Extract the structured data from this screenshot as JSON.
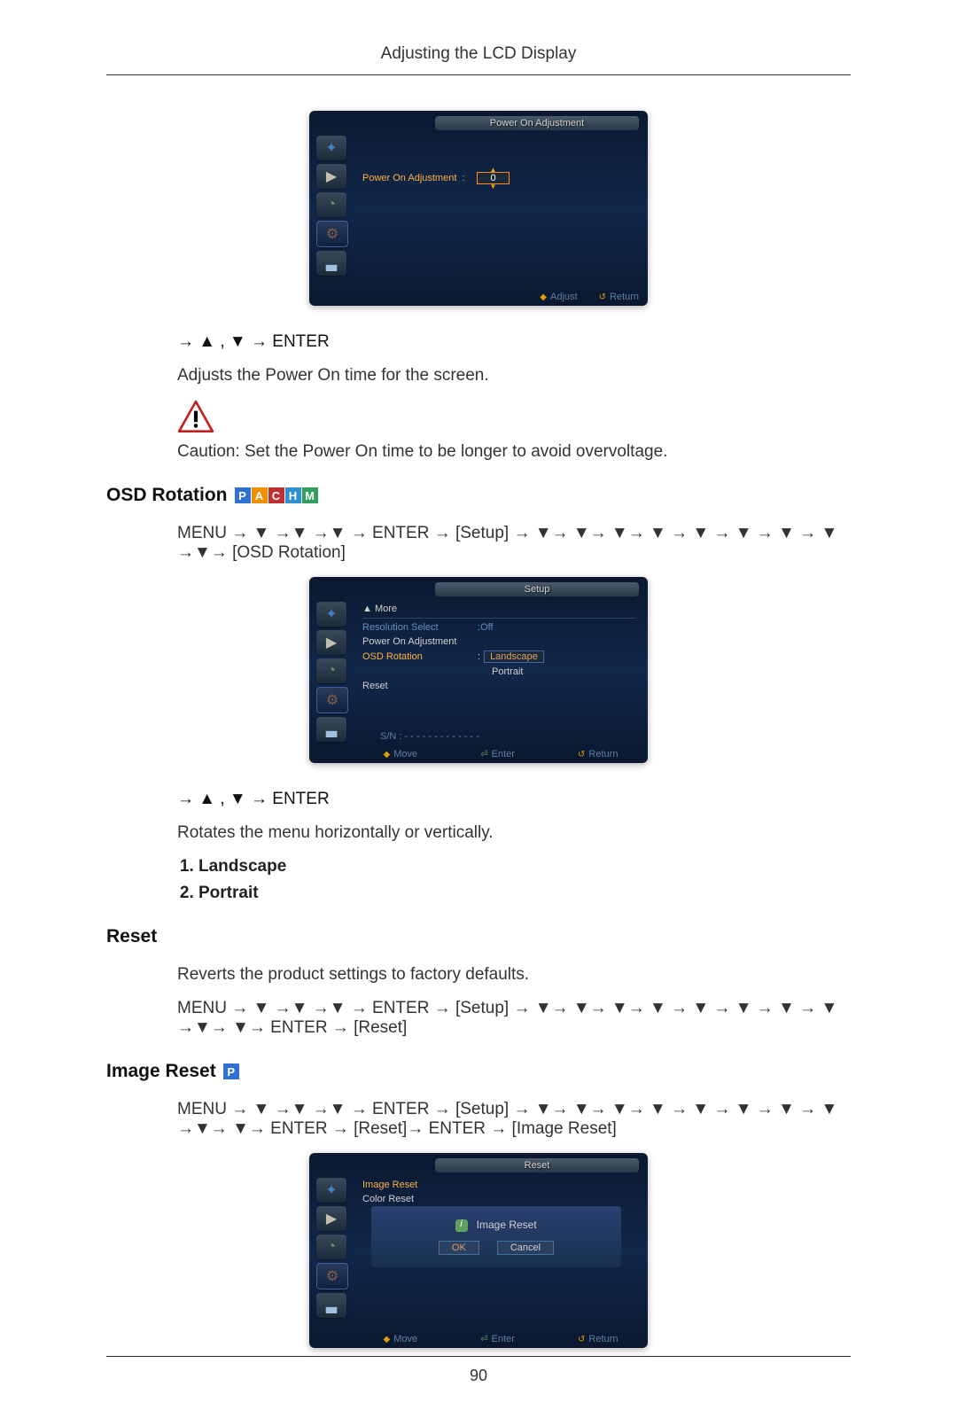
{
  "header": {
    "title": "Adjusting the LCD Display"
  },
  "osd1": {
    "title": "Power On Adjustment",
    "label": "Power On Adjustment",
    "value": "0",
    "footer": {
      "adjust": "Adjust",
      "return": "Return"
    }
  },
  "nav1": "→ ▲ , ▼ → ENTER",
  "body1": "Adjusts the Power On time for the screen.",
  "caution": "Caution: Set the Power On time to be longer to avoid overvoltage.",
  "section_osd_rotation": {
    "title": "OSD Rotation",
    "path": "MENU → ▼ →▼ →▼ → ENTER → [Setup] → ▼→ ▼→ ▼→ ▼ → ▼ → ▼ → ▼ → ▼ →▼→ [OSD Rotation]"
  },
  "osd2": {
    "title": "Setup",
    "more": "▲ More",
    "items": {
      "resolution": {
        "label": "Resolution Select",
        "value": "Off"
      },
      "poweron": {
        "label": "Power On Adjustment"
      },
      "osdrotation": {
        "label": "OSD Rotation",
        "selected": "Landscape",
        "alt": "Portrait"
      },
      "reset": {
        "label": "Reset"
      }
    },
    "sn": "S/N : - - - - - - - - - - - - -",
    "footer": {
      "move": "Move",
      "enter": "Enter",
      "return": "Return"
    }
  },
  "nav2": "→ ▲ , ▼ → ENTER",
  "body2": "Rotates the menu horizontally or vertically.",
  "options": [
    "Landscape",
    "Portrait"
  ],
  "section_reset": {
    "title": "Reset",
    "body": "Reverts the product settings to factory defaults.",
    "path": "MENU → ▼ →▼ →▼ → ENTER → [Setup] → ▼→ ▼→ ▼→ ▼ → ▼ → ▼ → ▼ → ▼ →▼→ ▼→ ENTER → [Reset]"
  },
  "section_image_reset": {
    "title": "Image Reset",
    "path": "MENU → ▼ →▼ →▼ → ENTER → [Setup] → ▼→ ▼→ ▼→ ▼ → ▼ → ▼ → ▼ → ▼ →▼→ ▼→ ENTER → [Reset]→ ENTER → [Image Reset]"
  },
  "osd3": {
    "title": "Reset",
    "items": {
      "image_reset": "Image Reset",
      "color_reset": "Color Reset"
    },
    "dialog": {
      "title": "Image Reset",
      "ok": "OK",
      "cancel": "Cancel"
    },
    "footer": {
      "move": "Move",
      "enter": "Enter",
      "return": "Return"
    }
  },
  "page_number": "90",
  "mode_letters": {
    "p": "P",
    "a": "A",
    "c": "C",
    "h": "H",
    "m": "M"
  }
}
